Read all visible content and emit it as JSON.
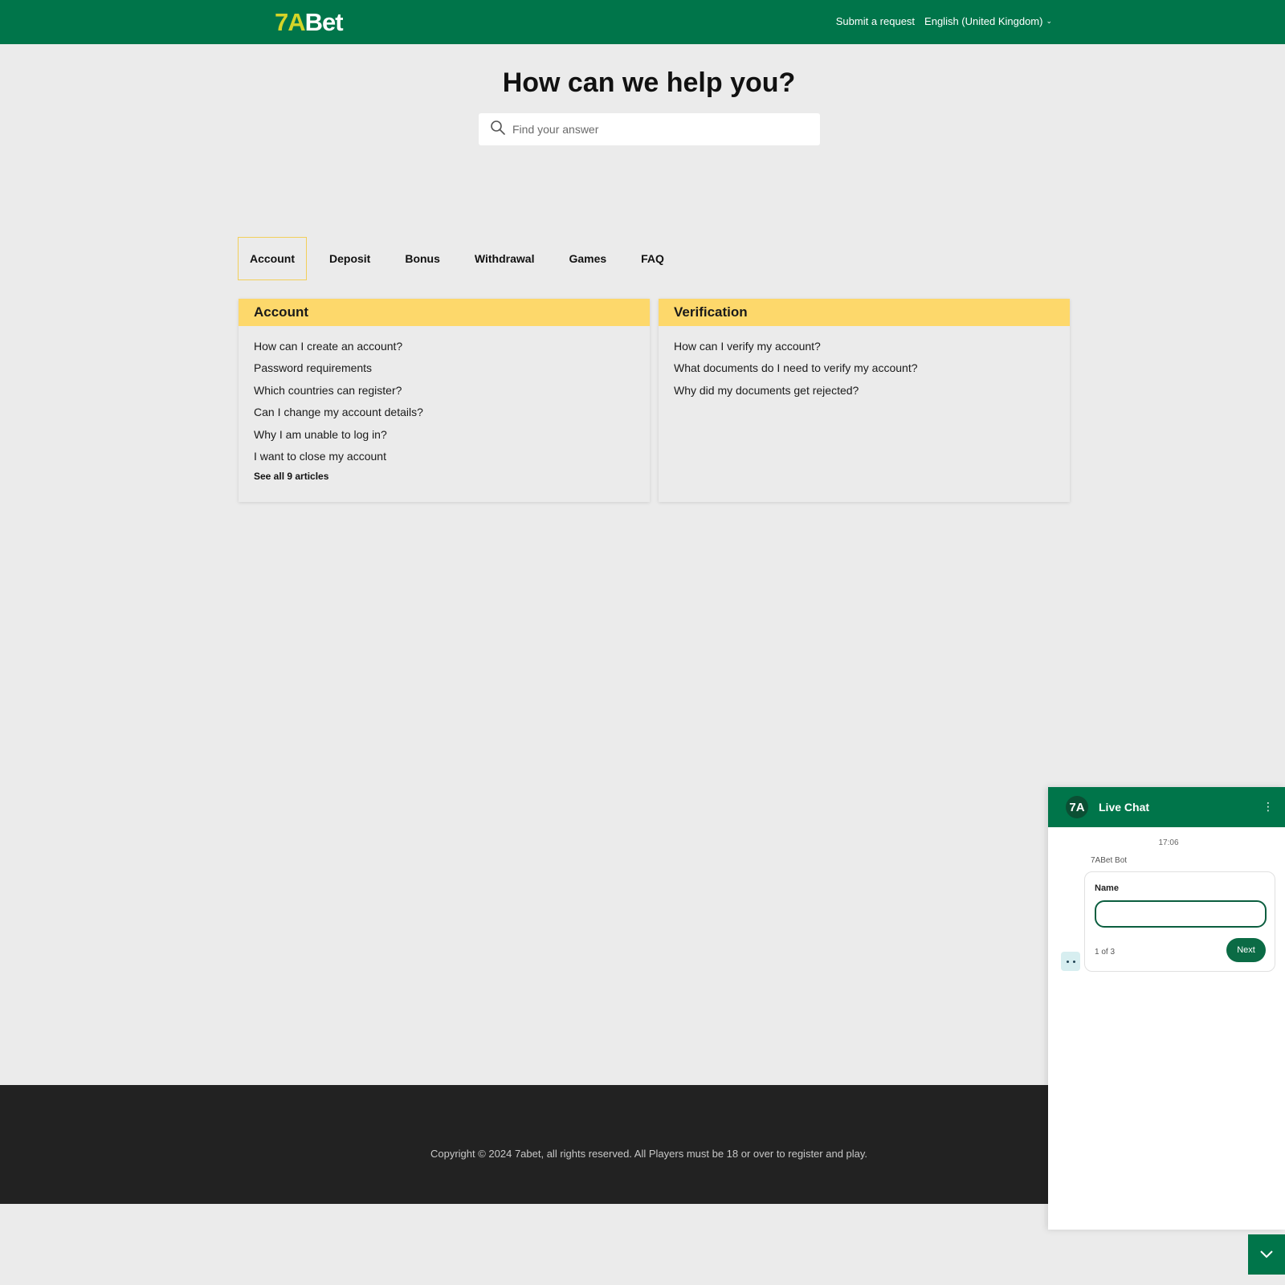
{
  "header": {
    "logo_seven": "7A",
    "logo_bet": "Bet",
    "submit_request": "Submit a request",
    "language": "English (United Kingdom)"
  },
  "hero": {
    "title": "How can we help you?",
    "search_placeholder": "Find your answer"
  },
  "tabs": [
    {
      "label": "Account",
      "active": true
    },
    {
      "label": "Deposit"
    },
    {
      "label": "Bonus"
    },
    {
      "label": "Withdrawal"
    },
    {
      "label": "Games"
    },
    {
      "label": "FAQ"
    }
  ],
  "sections": {
    "account": {
      "title": "Account",
      "articles": [
        "How can I create an account?",
        "Password requirements",
        "Which countries can register?",
        "Can I change my account details?",
        "Why I am unable to log in?",
        "I want to close my account"
      ],
      "see_all": "See all 9 articles"
    },
    "verification": {
      "title": "Verification",
      "articles": [
        "How can I verify my account?",
        "What documents do I need to verify my account?",
        "Why did my documents get rejected?"
      ]
    }
  },
  "footer": {
    "copyright": "Copyright © 2024 7abet, all rights reserved. All Players must be 18 or over to register and play."
  },
  "chat": {
    "avatar": "7A",
    "title": "Live Chat",
    "time": "17:06",
    "bot_name": "7ABet Bot",
    "field_label": "Name",
    "field_value": "",
    "step": "1 of 3",
    "next_label": "Next"
  },
  "colors": {
    "brand_green": "#00754a",
    "card_header_yellow": "#fdd86b",
    "footer_dark": "#222222"
  }
}
